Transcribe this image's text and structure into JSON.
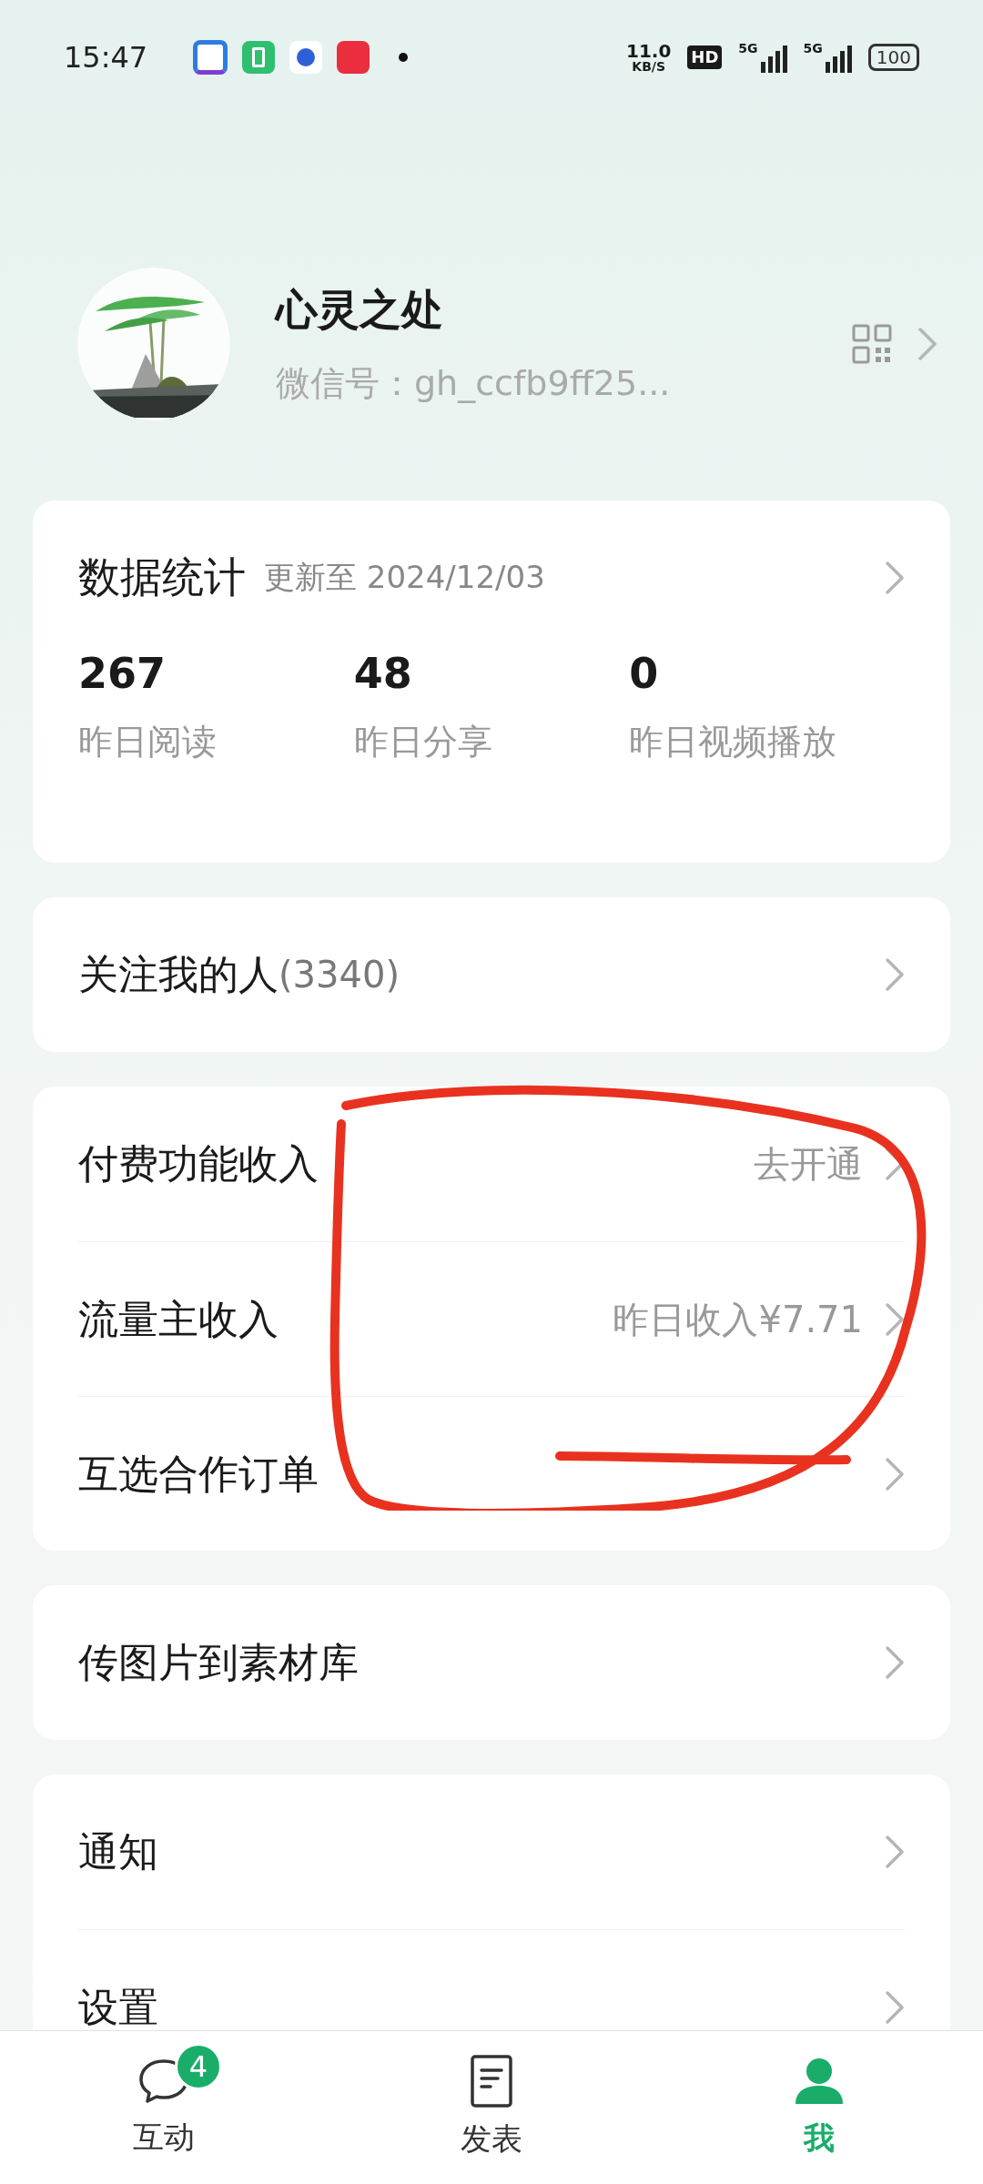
{
  "status_bar": {
    "time": "15:47",
    "speed": "11.0",
    "speed_unit": "KB/S",
    "hd": "HD",
    "net": [
      "5G",
      "5G"
    ],
    "battery": "100"
  },
  "profile": {
    "name": "心灵之处",
    "wechat_id": "微信号：gh_ccfb9ff25..."
  },
  "stats": {
    "title": "数据统计",
    "updated": "更新至 2024/12/03",
    "items": [
      {
        "value": "267",
        "label": "昨日阅读"
      },
      {
        "value": "48",
        "label": "昨日分享"
      },
      {
        "value": "0",
        "label": "昨日视频播放"
      }
    ]
  },
  "sections": [
    {
      "rows": [
        {
          "label": "关注我的人",
          "count": "(3340)"
        }
      ]
    },
    {
      "rows": [
        {
          "label": "付费功能收入",
          "value": "去开通"
        },
        {
          "label": "流量主收入",
          "value": "昨日收入¥7.71"
        },
        {
          "label": "互选合作订单"
        }
      ]
    },
    {
      "rows": [
        {
          "label": "传图片到素材库"
        }
      ]
    },
    {
      "rows": [
        {
          "label": "通知"
        },
        {
          "label": "设置"
        }
      ]
    }
  ],
  "tabs": [
    {
      "kind": "chat",
      "label": "互动",
      "badge": "4",
      "selected": false
    },
    {
      "kind": "doc",
      "label": "发表",
      "selected": false
    },
    {
      "kind": "person",
      "label": "我",
      "selected": true
    }
  ]
}
